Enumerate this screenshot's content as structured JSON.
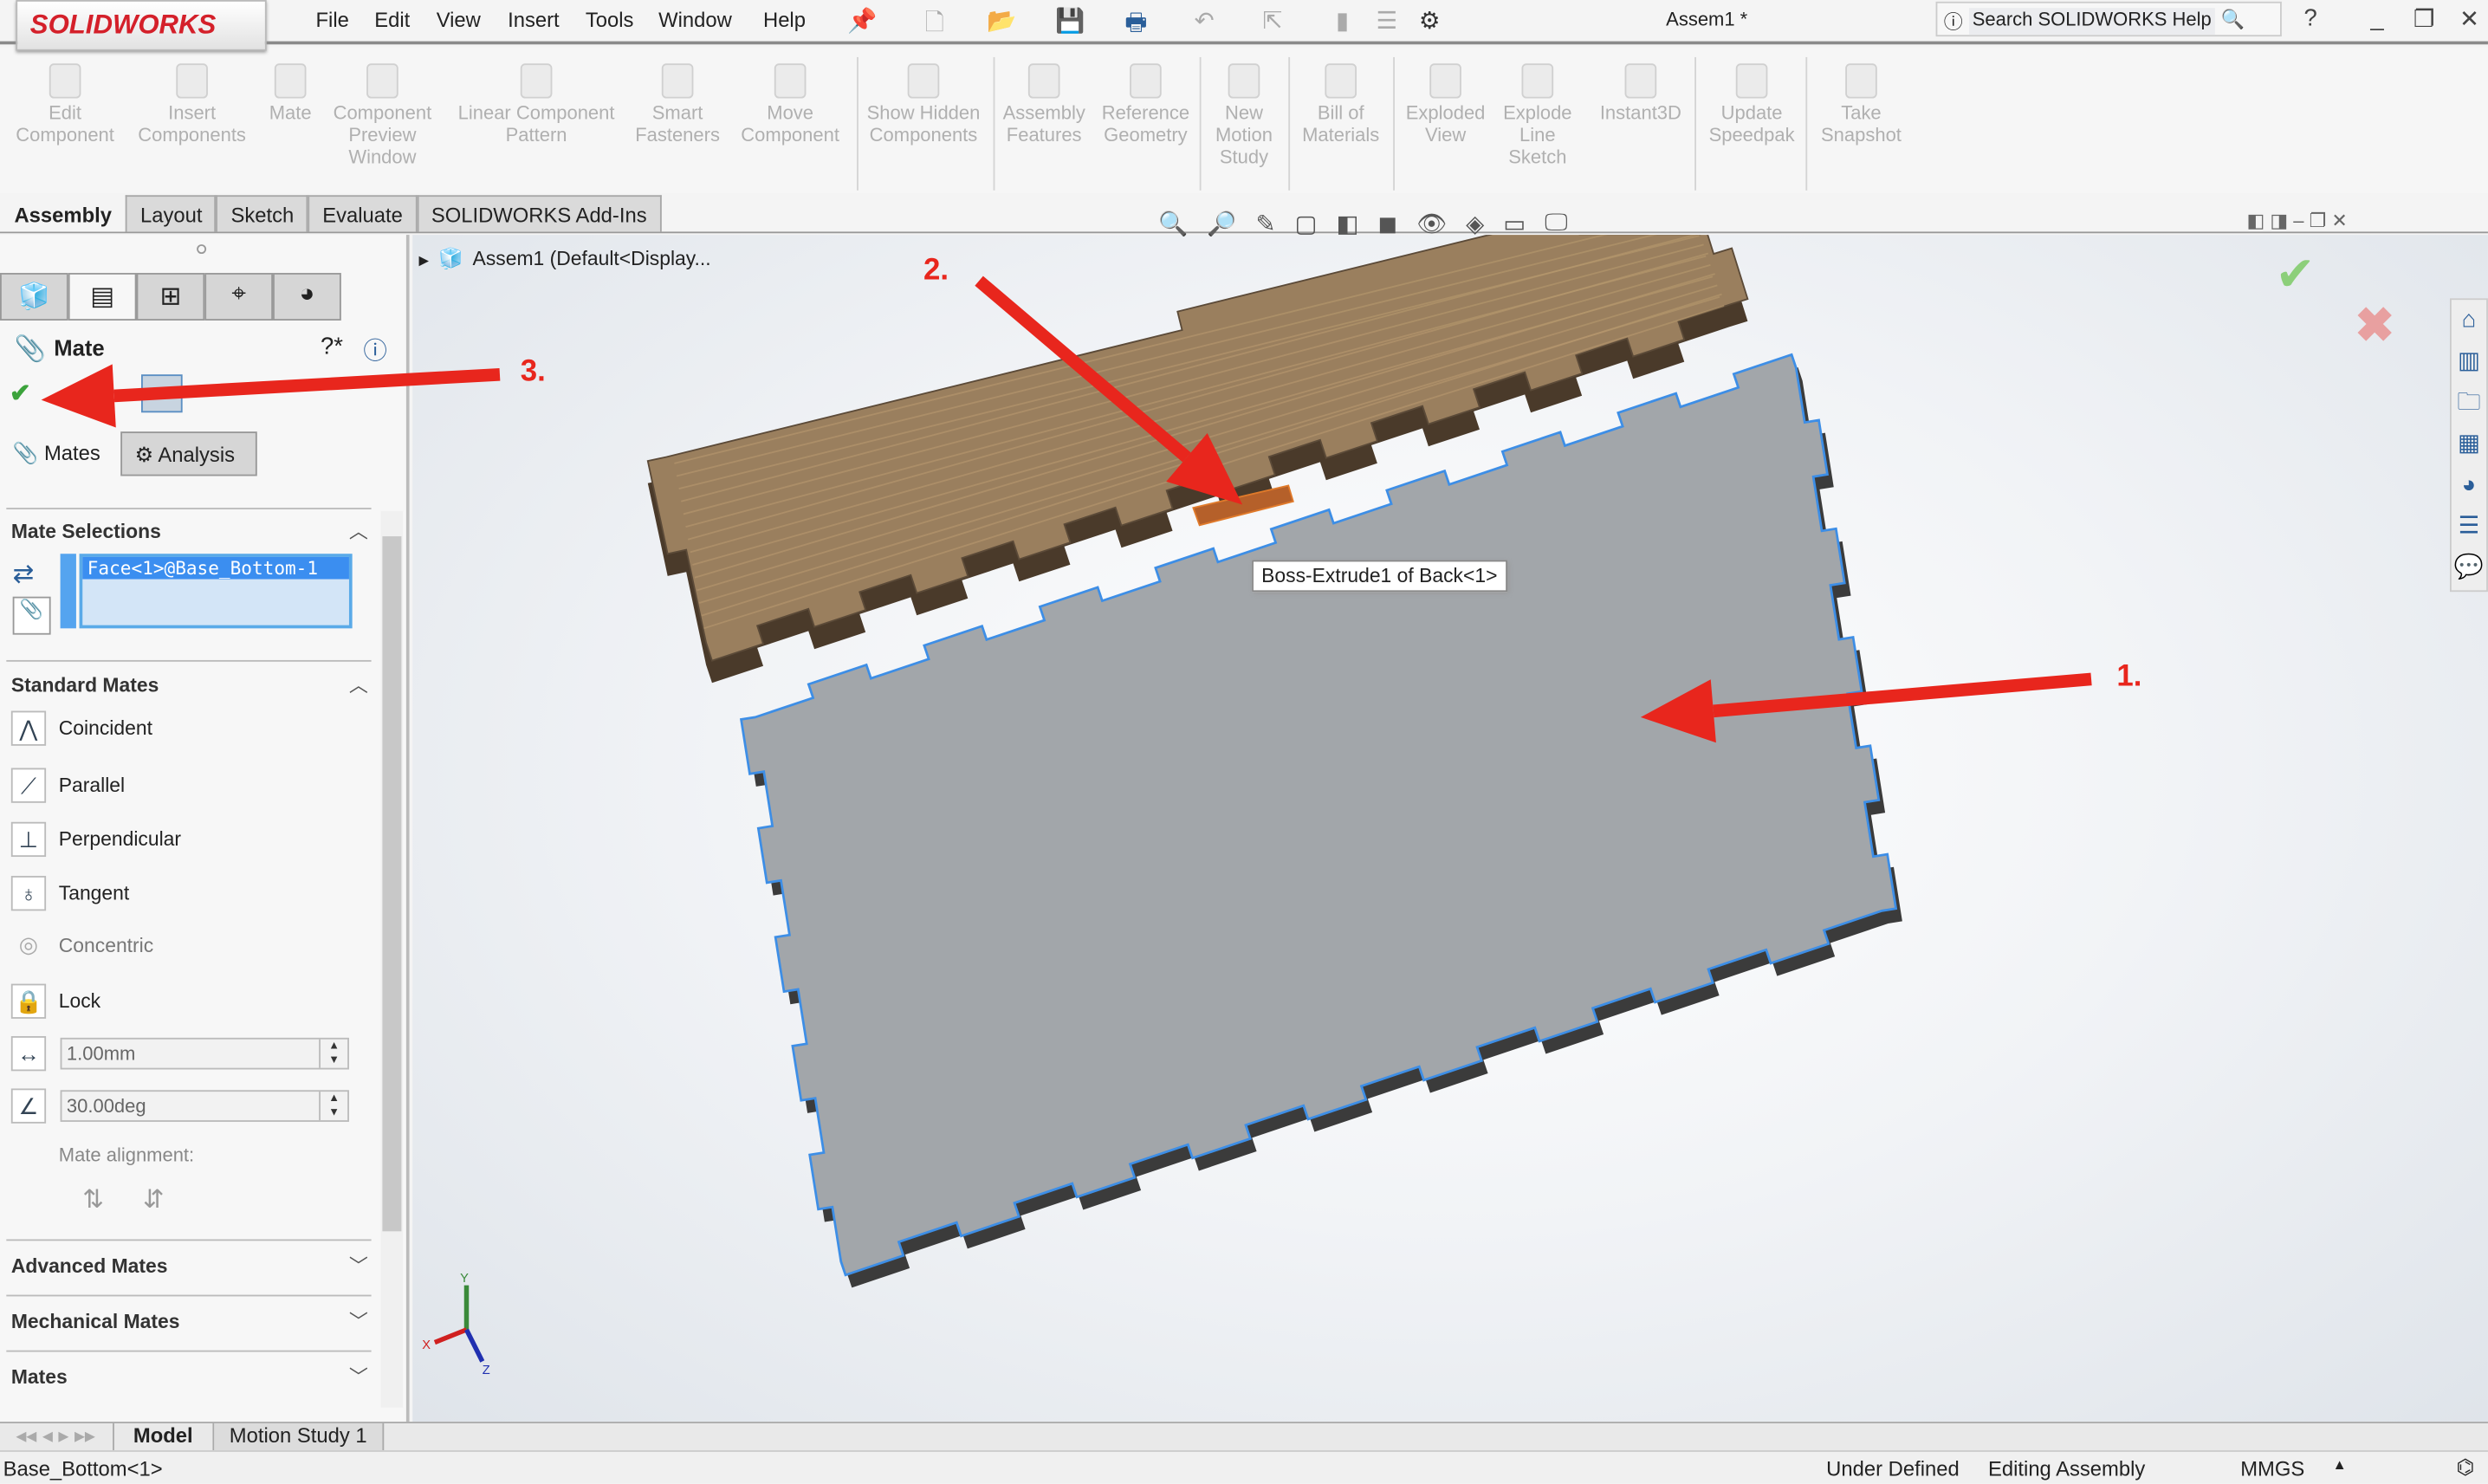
{
  "app": {
    "brand": "SOLIDWORKS",
    "doc_title": "Assem1 *",
    "help_search_placeholder": "Search SOLIDWORKS Help"
  },
  "menu": [
    "File",
    "Edit",
    "View",
    "Insert",
    "Tools",
    "Window",
    "Help"
  ],
  "ribbon": [
    "Edit Component",
    "Insert Components",
    "Mate",
    "Component Preview Window",
    "Linear Component Pattern",
    "Smart Fasteners",
    "Move Component",
    "Show Hidden Components",
    "Assembly Features",
    "Reference Geometry",
    "New Motion Study",
    "Bill of Materials",
    "Exploded View",
    "Explode Line Sketch",
    "Instant3D",
    "Update Speedpak",
    "Take Snapshot"
  ],
  "command_tabs": [
    "Assembly",
    "Layout",
    "Sketch",
    "Evaluate",
    "SOLIDWORKS Add-Ins"
  ],
  "panel": {
    "title": "Mate",
    "subtabs": [
      "Mates",
      "Analysis"
    ],
    "mate_selections": {
      "label": "Mate Selections",
      "items": [
        "Face<1>@Base_Bottom-1"
      ]
    },
    "standard_mates": {
      "label": "Standard Mates",
      "items": [
        "Coincident",
        "Parallel",
        "Perpendicular",
        "Tangent",
        "Concentric",
        "Lock"
      ]
    },
    "distance_value": "1.00mm",
    "angle_value": "30.00deg",
    "mate_alignment_label": "Mate alignment:",
    "collapsed_sections": [
      "Advanced Mates",
      "Mechanical Mates",
      "Mates"
    ]
  },
  "tree": {
    "root": "Assem1  (Default<Display..."
  },
  "viewport": {
    "tooltip": "Boss-Extrude1 of Back<1>",
    "annotations": [
      "1.",
      "2.",
      "3."
    ],
    "annotation_color": "#e8261d",
    "wood_color": "#9a7f5e",
    "plate_color": "#a2a6aa",
    "edge_highlight": "#3d8ee6"
  },
  "bottom_tabs": [
    "Model",
    "Motion Study 1"
  ],
  "status": {
    "selection": "Base_Bottom<1>",
    "state": "Under Defined",
    "mode": "Editing Assembly",
    "units": "MMGS"
  }
}
